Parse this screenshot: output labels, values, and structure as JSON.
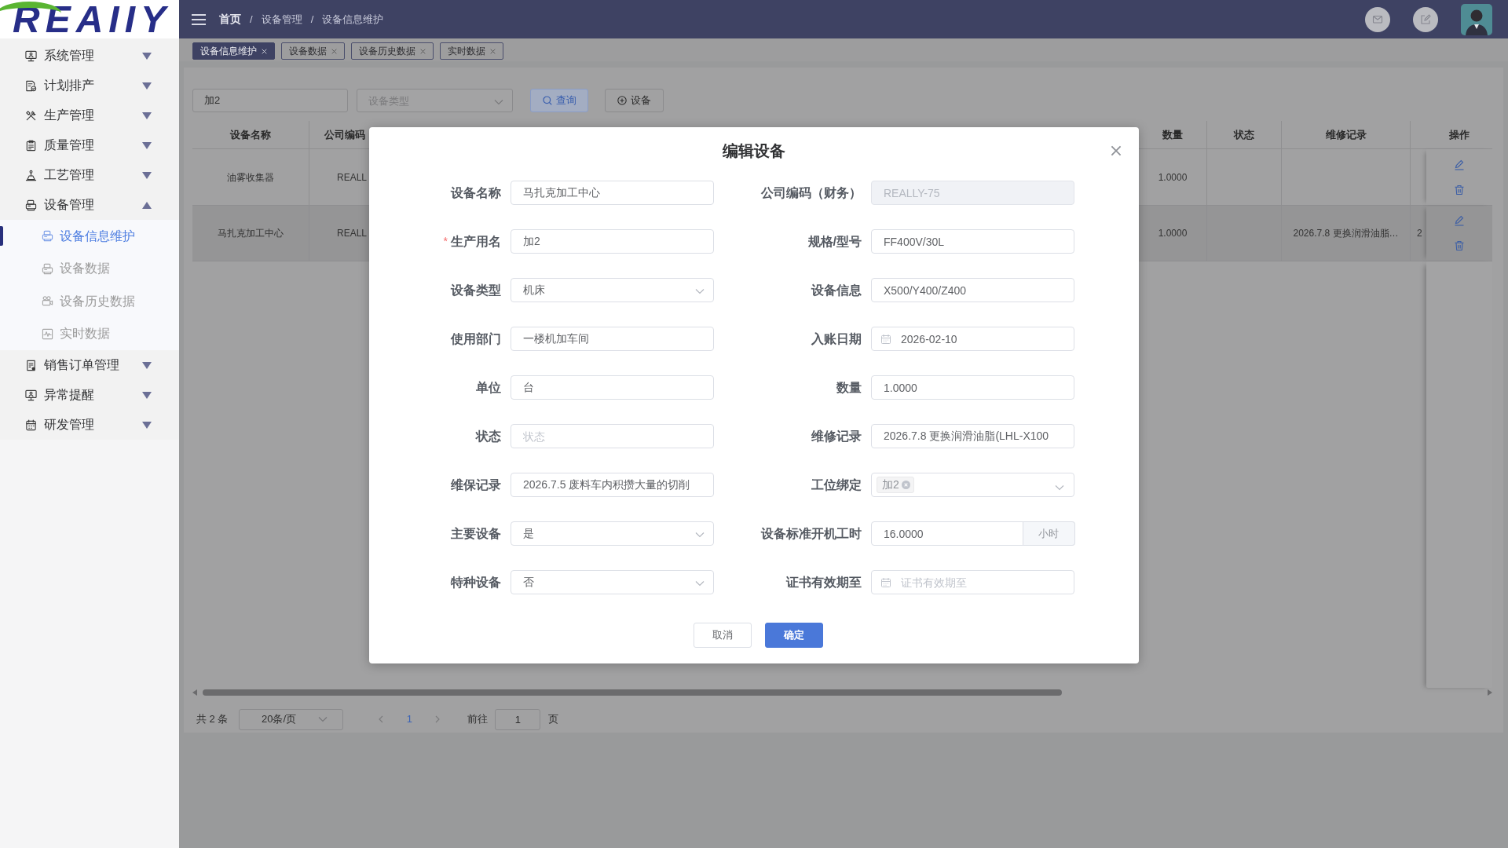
{
  "sidebar": {
    "logo": "REAIIY",
    "menu": [
      {
        "label": "系统管理",
        "expanded": false
      },
      {
        "label": "计划排产",
        "expanded": false
      },
      {
        "label": "生产管理",
        "expanded": false
      },
      {
        "label": "质量管理",
        "expanded": false
      },
      {
        "label": "工艺管理",
        "expanded": false
      },
      {
        "label": "设备管理",
        "expanded": true,
        "children": [
          {
            "label": "设备信息维护",
            "selected": true
          },
          {
            "label": "设备数据",
            "selected": false
          },
          {
            "label": "设备历史数据",
            "selected": false
          },
          {
            "label": "实时数据",
            "selected": false
          }
        ]
      },
      {
        "label": "销售订单管理",
        "expanded": false
      },
      {
        "label": "异常提醒",
        "expanded": false
      },
      {
        "label": "研发管理",
        "expanded": false
      }
    ]
  },
  "header": {
    "breadcrumb": [
      {
        "kind": "link",
        "text": "首页"
      },
      {
        "kind": "separator",
        "text": "/"
      },
      {
        "kind": "link",
        "text": "设备管理"
      },
      {
        "kind": "separator",
        "text": "/"
      },
      {
        "kind": "current",
        "text": "设备信息维护"
      }
    ]
  },
  "tabs": [
    {
      "label": "设备信息维护",
      "selected": true
    },
    {
      "label": "设备数据",
      "selected": false
    },
    {
      "label": "设备历史数据",
      "selected": false
    },
    {
      "label": "实时数据",
      "selected": false
    }
  ],
  "toolbar": {
    "search": {
      "value": "加2"
    },
    "type_filter": {
      "placeholder": "设备类型"
    },
    "buttons": [
      {
        "label": "查询",
        "kind": "search"
      },
      {
        "label": "设备",
        "kind": "add"
      }
    ]
  },
  "table": {
    "columns": [
      "设备名称",
      "公司编码",
      "数量",
      "状态",
      "维修记录",
      "操作"
    ],
    "rows": [
      {
        "name": "油雾收集器",
        "code": "REALL",
        "quantity": "1.0000",
        "selected": false
      },
      {
        "name": "马扎克加工中心",
        "code": "REALL",
        "quantity": "1.0000",
        "repair_record": "2026.7.8 更换润滑油脂…",
        "column_6": "2",
        "selected": true
      }
    ]
  },
  "pagination": {
    "total": "共 2 条",
    "page_size": "20条/页",
    "pages": [
      {
        "label": "1",
        "selected": true
      }
    ],
    "goto_label": "前往",
    "goto_value": "1",
    "page_suffix": "页"
  },
  "dialog": {
    "title": "编辑设备",
    "fields": [
      {
        "label": "设备名称",
        "kind": "text",
        "value": "马扎克加工中心",
        "disabled": false
      },
      {
        "label": "公司编码（财务）",
        "kind": "text",
        "value": "REALLY-75",
        "disabled": true
      },
      {
        "label": "生产用名",
        "kind": "text",
        "value": "加2",
        "required_mark": "*",
        "disabled": false
      },
      {
        "label": "规格/型号",
        "kind": "text",
        "value": "FF400V/30L",
        "disabled": false
      },
      {
        "label": "设备类型",
        "kind": "select",
        "value": "机床",
        "disabled": false
      },
      {
        "label": "设备信息",
        "kind": "text",
        "value": "X500/Y400/Z400",
        "disabled": false
      },
      {
        "label": "使用部门",
        "kind": "text",
        "value": "一楼机加车间",
        "disabled": false
      },
      {
        "label": "入账日期",
        "kind": "date",
        "value": "2026-02-10",
        "disabled": false
      },
      {
        "label": "单位",
        "kind": "text",
        "value": "台",
        "disabled": false
      },
      {
        "label": "数量",
        "kind": "text",
        "value": "1.0000",
        "disabled": false
      },
      {
        "label": "状态",
        "kind": "text",
        "placeholder": "状态",
        "disabled": false
      },
      {
        "label": "维修记录",
        "kind": "text",
        "value": "2026.7.8 更换润滑油脂(LHL-X100",
        "disabled": false
      },
      {
        "label": "维保记录",
        "kind": "text",
        "value": "2026.7.5 废料车内积攒大量的切削",
        "disabled": false
      },
      {
        "label": "工位绑定",
        "kind": "tags",
        "tags": [
          "加2"
        ],
        "disabled": false
      },
      {
        "label": "主要设备",
        "kind": "select",
        "value": "是",
        "disabled": false
      },
      {
        "label": "设备标准开机工时",
        "kind": "unit",
        "value": "16.0000",
        "unit": "小时",
        "disabled": false
      },
      {
        "label": "特种设备",
        "kind": "select",
        "value": "否",
        "disabled": false
      },
      {
        "label": "证书有效期至",
        "kind": "date",
        "placeholder": "证书有效期至",
        "disabled": false
      }
    ],
    "buttons": [
      {
        "label": "取消",
        "kind": "default"
      },
      {
        "label": "确定",
        "kind": "primary"
      }
    ]
  }
}
